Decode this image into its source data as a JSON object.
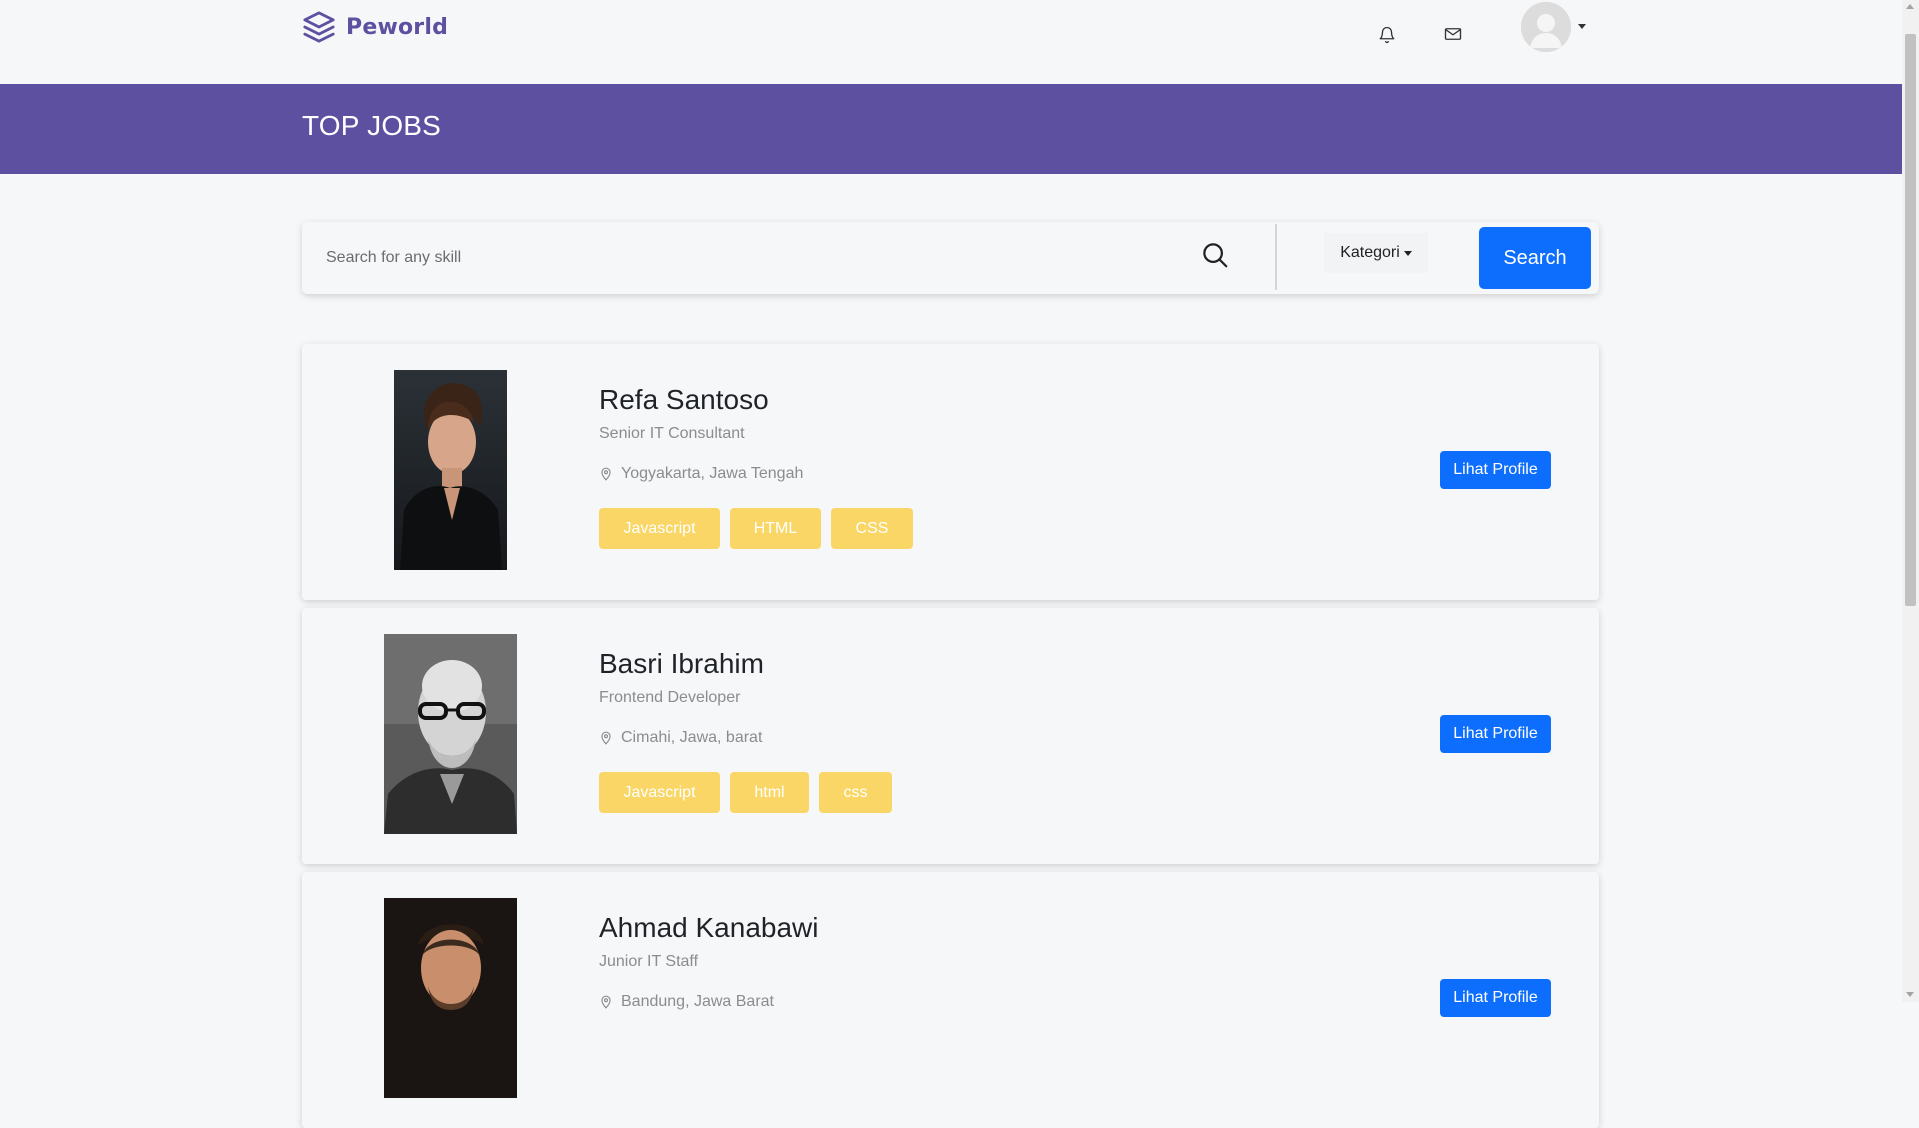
{
  "brand": {
    "name": "Peworld",
    "logo_icon": "layers-icon",
    "color": "#5e50a1"
  },
  "nav": {
    "bell_icon": "bell-icon",
    "mail_icon": "mail-icon",
    "avatar_icon": "user-avatar-icon"
  },
  "header": {
    "title": "TOP JOBS",
    "background": "#5e50a1"
  },
  "search": {
    "placeholder": "Search for any skill",
    "value": "",
    "icon": "search-icon",
    "category_label": "Kategori",
    "button_label": "Search",
    "button_color": "#0d6efd"
  },
  "profiles": [
    {
      "name": "Refa Santoso",
      "job": "Senior IT Consultant",
      "location": "Yogyakarta, Jawa Tengah",
      "skills": [
        "Javascript",
        "HTML",
        "CSS"
      ],
      "button_label": "Lihat Profile"
    },
    {
      "name": "Basri Ibrahim",
      "job": "Frontend Developer",
      "location": "Cimahi, Jawa, barat",
      "skills": [
        "Javascript",
        "html",
        "css"
      ],
      "button_label": "Lihat Profile"
    },
    {
      "name": "Ahmad Kanabawi",
      "job": "Junior IT Staff",
      "location": "Bandung, Jawa Barat",
      "skills": [],
      "button_label": "Lihat Profile"
    }
  ],
  "colors": {
    "skill_badge": "#f9d665",
    "accent_button": "#0d6efd"
  }
}
